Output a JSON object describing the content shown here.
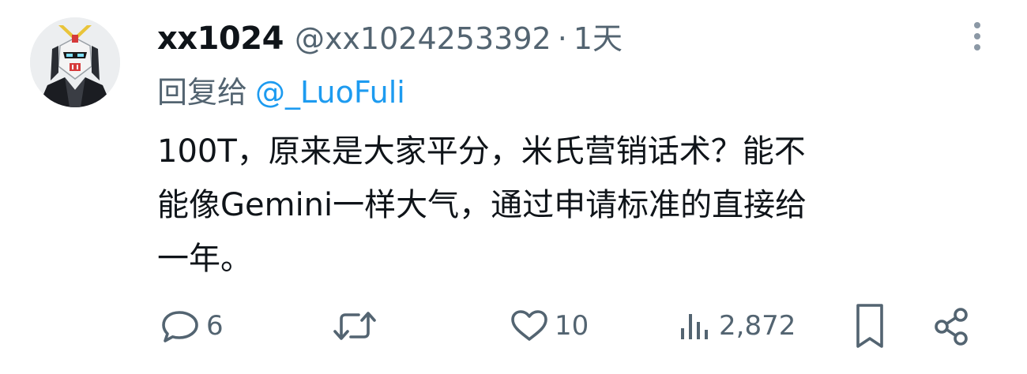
{
  "tweet": {
    "display_name": "xx1024",
    "handle": "@xx1024253392",
    "separator": "·",
    "time": "1天",
    "reply_label": "回复给",
    "reply_target": "@_LuoFuli",
    "body_lines": [
      "100T，原来是大家平分，米氏营销话术？能不",
      "能像Gemini一样大气，通过申请标准的直接给",
      "一年。"
    ]
  },
  "actions": {
    "reply_count": "6",
    "repost_count": "",
    "like_count": "10",
    "views_count": "2,872"
  },
  "icons": {
    "avatar": "gundam-avatar",
    "more": "more-vertical-icon",
    "reply": "reply-icon",
    "repost": "repost-icon",
    "like": "heart-icon",
    "views": "views-icon",
    "bookmark": "bookmark-icon",
    "share": "share-icon"
  },
  "colors": {
    "text": "#0f1419",
    "secondary": "#536471",
    "link": "#1d9bf0"
  }
}
